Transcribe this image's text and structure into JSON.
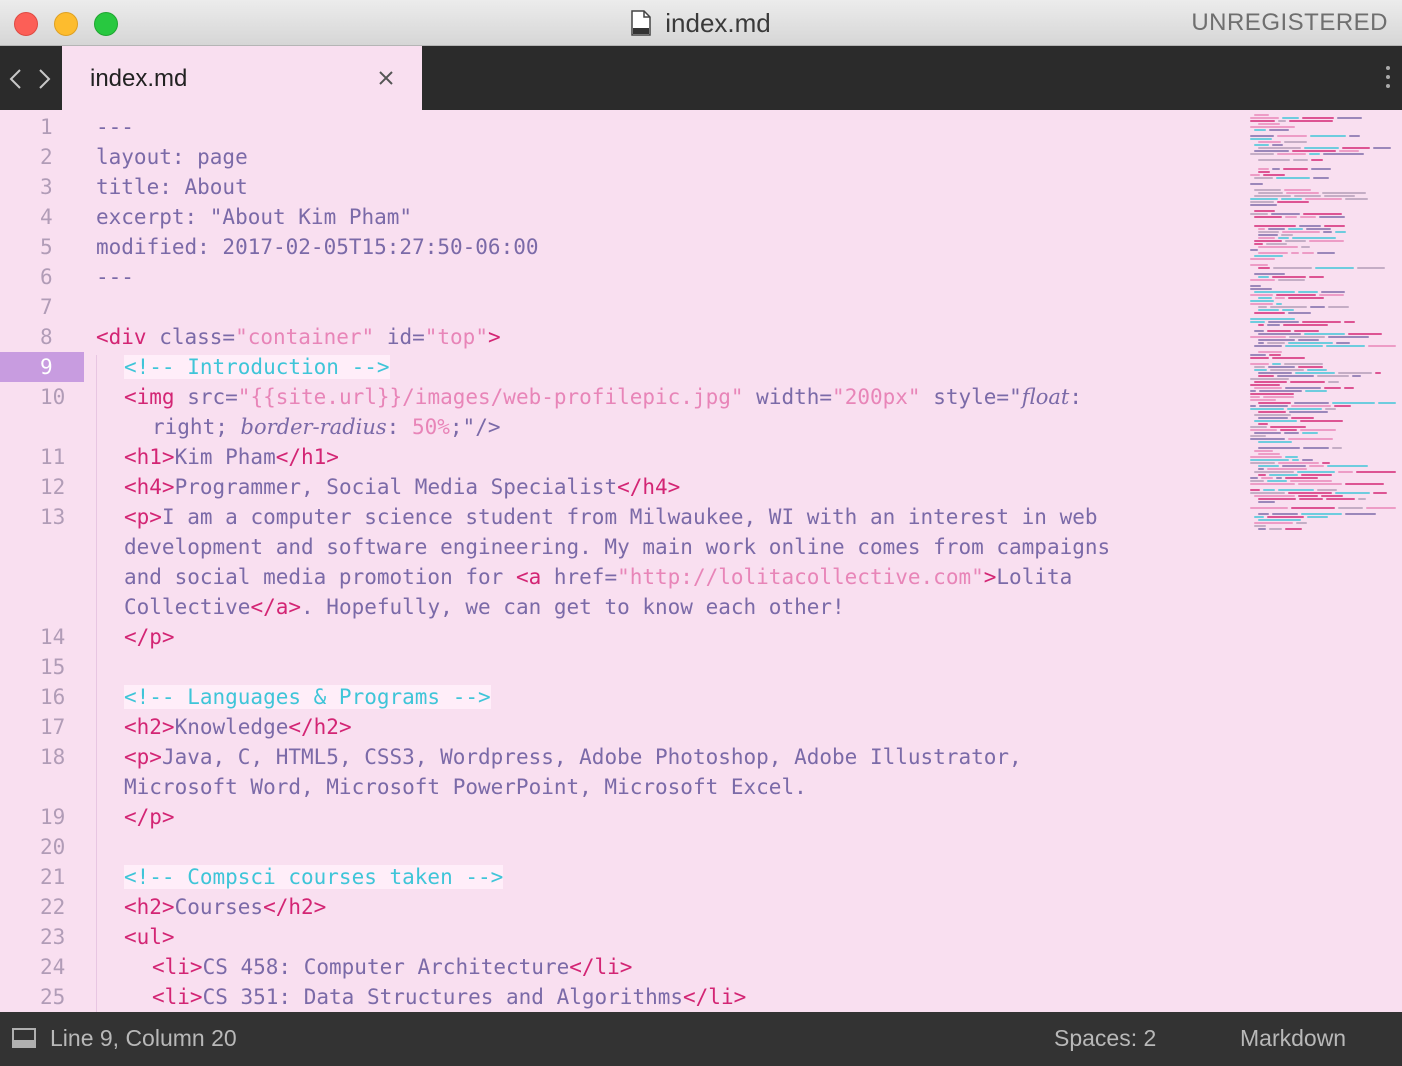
{
  "window": {
    "title": "index.md",
    "registration": "UNREGISTERED"
  },
  "tab": {
    "label": "index.md"
  },
  "editor": {
    "line_numbers": [
      "1",
      "2",
      "3",
      "4",
      "5",
      "6",
      "7",
      "8",
      "9",
      "10",
      "11",
      "12",
      "13",
      "14",
      "15",
      "16",
      "17",
      "18",
      "19",
      "20",
      "21",
      "22",
      "23",
      "24",
      "25"
    ],
    "current_line": "9",
    "code": {
      "l1": "---",
      "l2": "layout: page",
      "l3": "title: About",
      "l4": "excerpt: \"About Kim Pham\"",
      "l5": "modified: 2017-02-05T15:27:50-06:00",
      "l6": "---",
      "l8_open": "<div",
      "l8_attr1": " class=",
      "l8_val1": "\"container\"",
      "l8_attr2": " id=",
      "l8_val2": "\"top\"",
      "l8_close": ">",
      "l9_comment": "<!-- Introduction -->",
      "l10_open": "<img",
      "l10_attr1": " src=",
      "l10_val1": "\"{{site.url}}/images/web-profilepic.jpg\"",
      "l10_attr2": " width=",
      "l10_val2": "\"200px\"",
      "l10_attr3": " style=\"",
      "l10_prop1": "float",
      "l10_colon": ":",
      "l10b_value1": "right",
      "l10b_semi": "; ",
      "l10b_prop2": "border-radius",
      "l10b_colon": ": ",
      "l10b_value2": "50%",
      "l10b_end": ";\"/>",
      "l11_open": "<h1>",
      "l11_text": "Kim Pham",
      "l11_close": "</h1>",
      "l12_open": "<h4>",
      "l12_text": "Programmer, Social Media Specialist",
      "l12_close": "</h4>",
      "l13_open": "<p>",
      "l13_text": "I am a computer science student from Milwaukee, WI with an interest in web",
      "l13b_text": "development and software engineering. My main work online comes from campaigns",
      "l13c_text": "and social media promotion for ",
      "l13c_a": "<a",
      "l13c_attr": " href=",
      "l13c_val": "\"http://lolitacollective.com\"",
      "l13c_gt": ">",
      "l13c_text2": "Lolita",
      "l13d_text": "Collective",
      "l13d_aclose": "</a>",
      "l13d_text2": ". Hopefully, we can get to know each other!",
      "l14": "</p>",
      "l16_comment": "<!-- Languages & Programs -->",
      "l17_open": "<h2>",
      "l17_text": "Knowledge",
      "l17_close": "</h2>",
      "l18_open": "<p>",
      "l18_text": "Java, C, HTML5, CSS3, Wordpress, Adobe Photoshop, Adobe Illustrator,",
      "l18b_text": "Microsoft Word, Microsoft PowerPoint, Microsoft Excel.",
      "l19": "</p>",
      "l21_comment": "<!-- Compsci courses taken -->",
      "l22_open": "<h2>",
      "l22_text": "Courses",
      "l22_close": "</h2>",
      "l23": "<ul>",
      "l24_open": "<li>",
      "l24_text": "CS 458: Computer Architecture",
      "l24_close": "</li>",
      "l25_open": "<li>",
      "l25_text": "CS 351: Data Structures and Algorithms",
      "l25_close": "</li>"
    }
  },
  "status": {
    "position": "Line 9, Column 20",
    "indentation": "Spaces: 2",
    "syntax": "Markdown"
  },
  "colors": {
    "background": "#f9dff0",
    "tag": "#d32574",
    "string": "#e885b8",
    "comment": "#3fc5d8",
    "text": "#7b6aa8",
    "current_line": "#c89ce0",
    "chrome_dark": "#2b2b2b"
  }
}
